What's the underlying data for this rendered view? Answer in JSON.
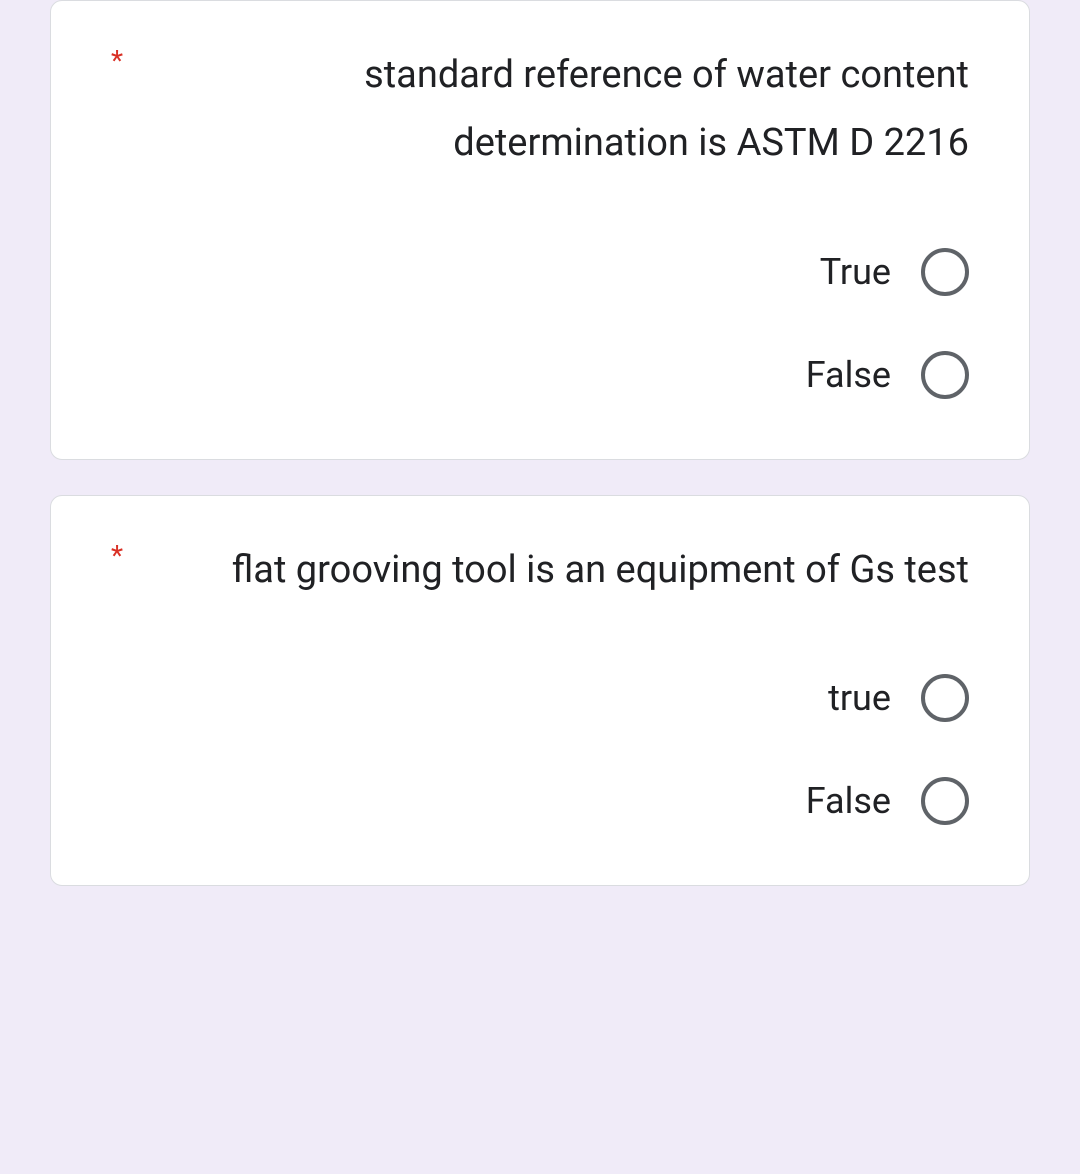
{
  "questions": [
    {
      "required": "*",
      "text": "standard reference of water content determination is ASTM D 2216",
      "options": [
        {
          "label": "True"
        },
        {
          "label": "False"
        }
      ]
    },
    {
      "required": "*",
      "text": "flat grooving tool is an equipment of Gs test",
      "options": [
        {
          "label": "true"
        },
        {
          "label": "False"
        }
      ]
    }
  ]
}
